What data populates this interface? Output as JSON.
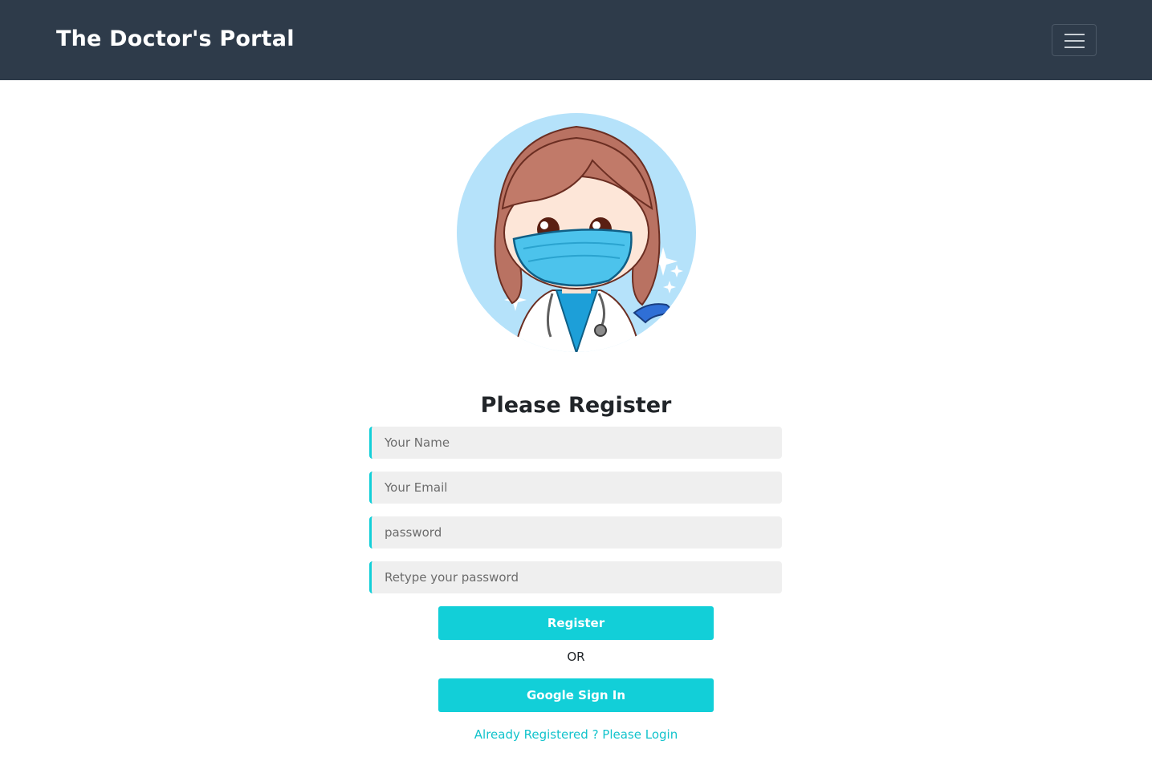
{
  "navbar": {
    "brand": "The Doctor's Portal",
    "menu_icon": "hamburger-menu-icon"
  },
  "illustration": {
    "description_icon": "doctor-avatar-illustration",
    "circle_color": "#b5e2fa"
  },
  "form": {
    "title": "Please Register",
    "name_placeholder": "Your Name",
    "email_placeholder": "Your Email",
    "password_placeholder": "password",
    "retype_placeholder": "Retype your password",
    "register_label": "Register",
    "or_label": "OR",
    "google_label": "Google Sign In",
    "login_link": "Already Registered ? Please Login"
  },
  "colors": {
    "navbar_bg": "#2e3b4a",
    "accent": "#12cfd8",
    "input_bg": "#efefef"
  }
}
